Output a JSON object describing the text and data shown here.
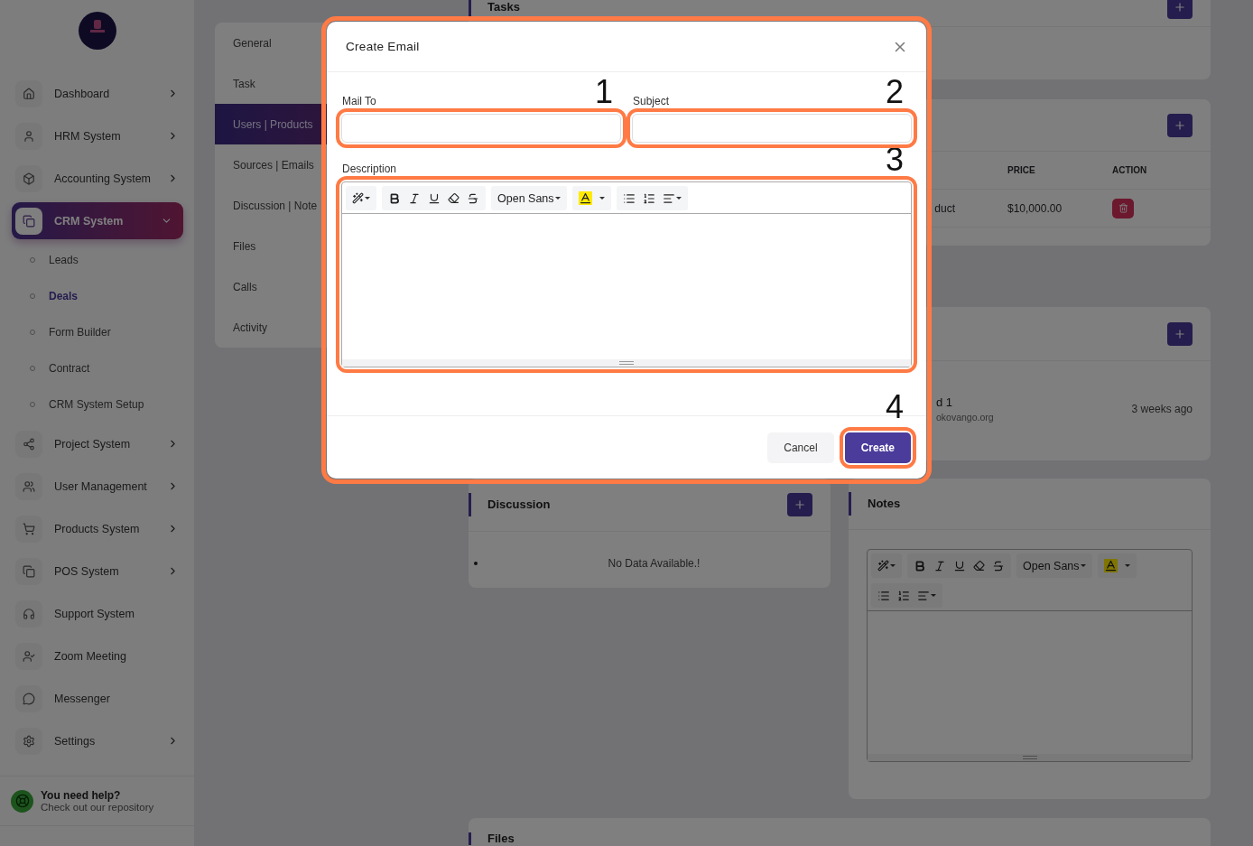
{
  "sidebar": {
    "items": [
      {
        "label": "Dashboard",
        "has_submenu": true,
        "selected": false,
        "expanded": false
      },
      {
        "label": "HRM System",
        "has_submenu": true,
        "selected": false,
        "expanded": false
      },
      {
        "label": "Accounting System",
        "has_submenu": true,
        "selected": false,
        "expanded": false
      },
      {
        "label": "CRM System",
        "has_submenu": true,
        "selected": true,
        "expanded": true,
        "children": [
          {
            "label": "Leads",
            "selected": false
          },
          {
            "label": "Deals",
            "selected": true
          },
          {
            "label": "Form Builder",
            "selected": false
          },
          {
            "label": "Contract",
            "selected": false
          },
          {
            "label": "CRM System Setup",
            "selected": false
          }
        ]
      },
      {
        "label": "Project System",
        "has_submenu": true,
        "selected": false,
        "expanded": false
      },
      {
        "label": "User Management",
        "has_submenu": true,
        "selected": false,
        "expanded": false
      },
      {
        "label": "Products System",
        "has_submenu": true,
        "selected": false,
        "expanded": false
      },
      {
        "label": "POS System",
        "has_submenu": true,
        "selected": false,
        "expanded": false
      },
      {
        "label": "Support System",
        "has_submenu": false,
        "selected": false
      },
      {
        "label": "Zoom Meeting",
        "has_submenu": false,
        "selected": false
      },
      {
        "label": "Messenger",
        "has_submenu": false,
        "selected": false
      },
      {
        "label": "Settings",
        "has_submenu": true,
        "selected": false,
        "expanded": false
      }
    ],
    "help": {
      "title": "You need help?",
      "text": "Check out our repository"
    }
  },
  "tabs": [
    {
      "label": "General",
      "selected": false
    },
    {
      "label": "Task",
      "selected": false
    },
    {
      "label": "Users | Products",
      "selected": true
    },
    {
      "label": "Sources | Emails",
      "selected": false
    },
    {
      "label": "Discussion | Note",
      "selected": false
    },
    {
      "label": "Files",
      "selected": false
    },
    {
      "label": "Calls",
      "selected": false
    },
    {
      "label": "Activity",
      "selected": false
    }
  ],
  "tasks_card": {
    "title": "Tasks"
  },
  "products_card": {
    "columns": [
      "PRICE",
      "ACTION"
    ],
    "rows": [
      {
        "column_1": "duct",
        "price": "$10,000.00"
      }
    ]
  },
  "leads_card": {
    "rows": [
      {
        "name": "d 1",
        "email": "okovango.org",
        "time": "3 weeks ago"
      }
    ]
  },
  "discussion": {
    "title": "Discussion",
    "empty_text": "No Data Available.!"
  },
  "notes": {
    "title": "Notes",
    "editor": {
      "font": "Open Sans"
    }
  },
  "files": {
    "title": "Files"
  },
  "modal": {
    "title": "Create Email",
    "fields": [
      {
        "label": "Mail To",
        "marker": "1"
      },
      {
        "label": "Subject",
        "marker": "2"
      }
    ],
    "description": {
      "label": "Description",
      "marker": "3",
      "editor": {
        "font": "Open Sans"
      }
    },
    "buttons": [
      {
        "label": "Cancel",
        "kind": "secondary"
      },
      {
        "label": "Create",
        "kind": "primary",
        "marker": "4"
      }
    ]
  }
}
